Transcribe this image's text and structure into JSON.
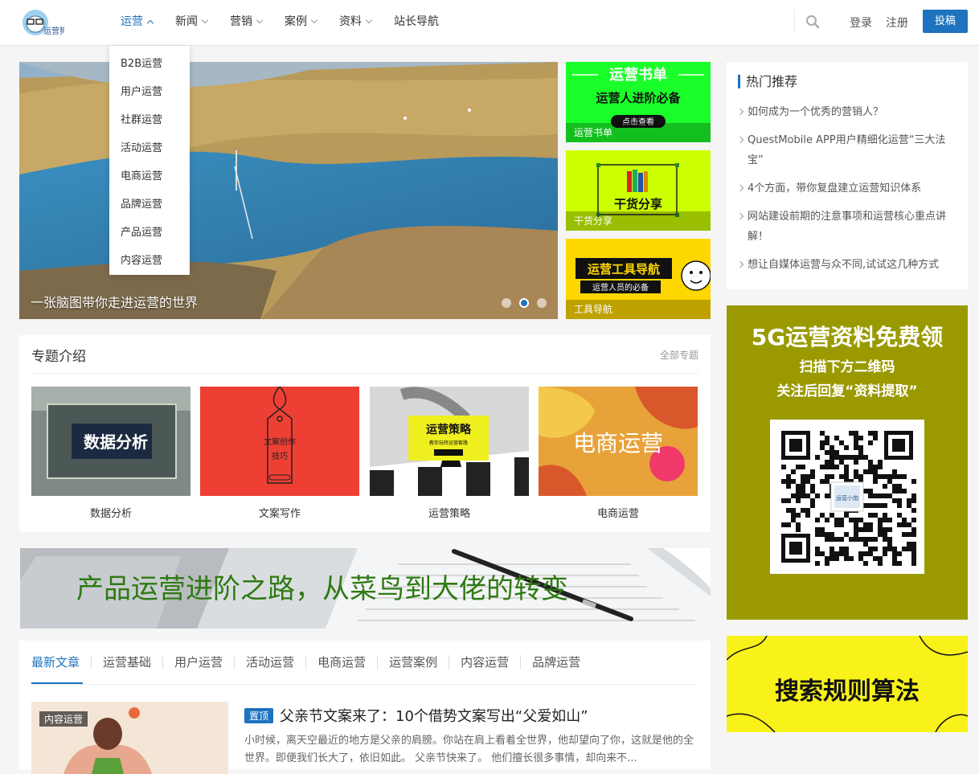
{
  "header": {
    "logo_text": "运营狗",
    "nav": [
      {
        "label": "运营",
        "active": true
      },
      {
        "label": "新闻"
      },
      {
        "label": "营销"
      },
      {
        "label": "案例"
      },
      {
        "label": "资料"
      },
      {
        "label": "站长导航"
      }
    ],
    "login": "登录",
    "register": "注册",
    "post": "投稿"
  },
  "dropdown": [
    "B2B运营",
    "用户运营",
    "社群运营",
    "活动运营",
    "电商运营",
    "品牌运营",
    "产品运营",
    "内容运营"
  ],
  "slider": {
    "caption": "一张脑图带你走进运营的世界"
  },
  "side_cards": [
    {
      "caption": "运营书单",
      "title": "运营书单",
      "subtitle": "运营人进阶必备",
      "button": "点击查看",
      "color": "#1aff2a"
    },
    {
      "caption": "干货分享",
      "title": "干货分享",
      "color": "#ccff00"
    },
    {
      "caption": "工具导航",
      "title": "运营工具导航",
      "subtitle": "运营人员的必备",
      "color": "#ffd700"
    }
  ],
  "topics": {
    "title": "专题介绍",
    "more": "全部专题",
    "items": [
      {
        "label": "数据分析",
        "image_text": "数据分析"
      },
      {
        "label": "文案写作",
        "image_text": "文案创作",
        "image_text2": "技巧"
      },
      {
        "label": "运营策略",
        "image_text": "运营策略",
        "image_text2": "教你玩转运营套路"
      },
      {
        "label": "电商运营",
        "image_text": "电商运营"
      }
    ]
  },
  "banner": {
    "text": "产品运营进阶之路，从菜鸟到大佬的转变"
  },
  "articles": {
    "tabs": [
      "最新文章",
      "运营基础",
      "用户运营",
      "活动运营",
      "电商运营",
      "运营案例",
      "内容运营",
      "品牌运营"
    ],
    "first": {
      "badge": "内容运营",
      "pin": "置顶",
      "title": "父亲节文案来了：10个借势文案写出“父爱如山”",
      "desc": "小时候，离天空最近的地方是父亲的肩膀。你站在肩上看着全世界，他却望向了你，这就是他的全世界。即便我们长大了，依旧如此。 父亲节快来了。 他们擅长很多事情，却向来不..."
    }
  },
  "hot": {
    "title": "热门推荐",
    "items": [
      "如何成为一个优秀的营销人？",
      "QuestMobile APP用户精细化运营“三大法宝”",
      "4个方面，带你复盘建立运营知识体系",
      "网站建设前期的注意事项和运营核心重点讲解！",
      "想让自媒体运营与众不同,试试这几种方式"
    ]
  },
  "ad_5g": {
    "title": "5G运营资料免费领",
    "line1": "扫描下方二维码",
    "line2": "关注后回复“资料提取”",
    "qr_label": "运营小炮"
  },
  "ad_search": {
    "text": "搜索规则算法"
  }
}
